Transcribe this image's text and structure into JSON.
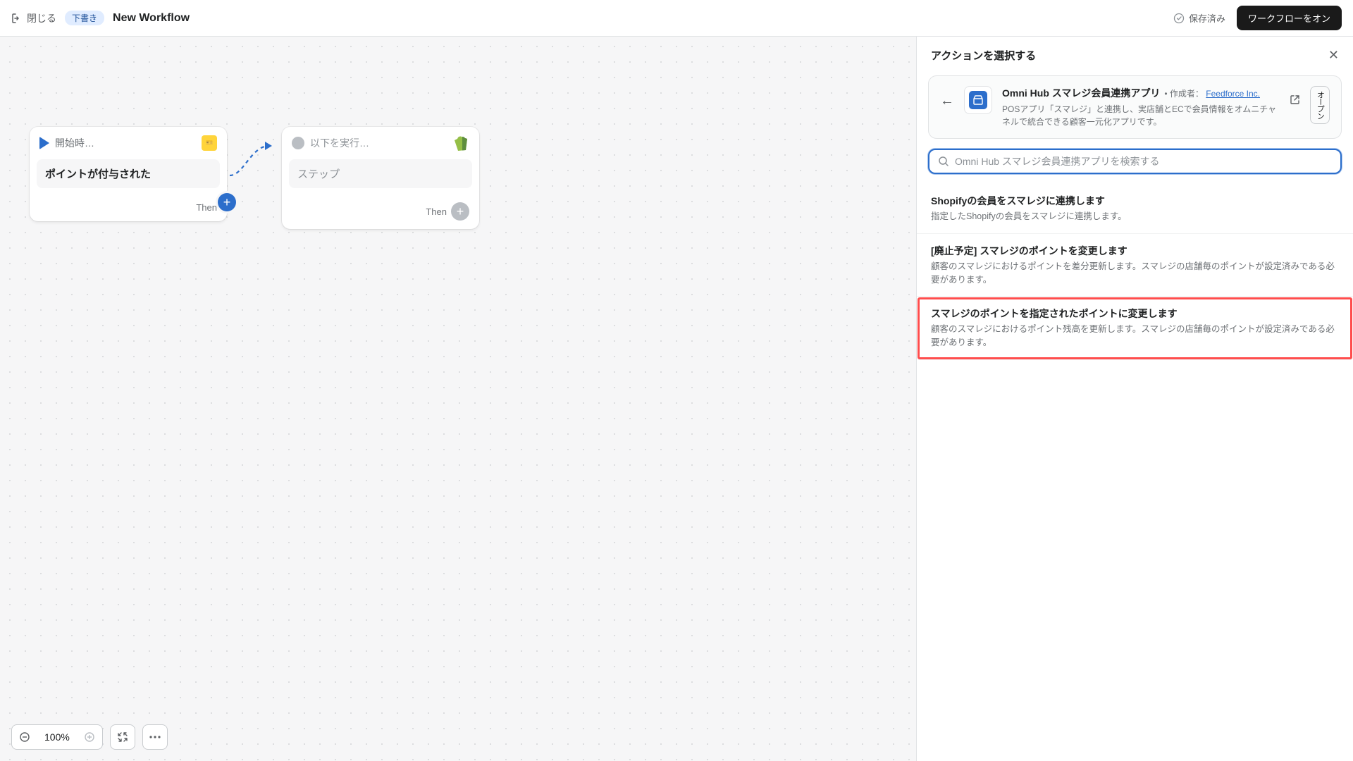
{
  "header": {
    "close_label": "閉じる",
    "draft_badge": "下書き",
    "title": "New Workflow",
    "saved_label": "保存済み",
    "enable_button": "ワークフローをオン"
  },
  "canvas": {
    "node1": {
      "header": "開始時…",
      "body": "ポイントが付与された",
      "then": "Then"
    },
    "node2": {
      "header": "以下を実行…",
      "body": "ステップ",
      "then": "Then"
    },
    "zoom": "100%"
  },
  "panel": {
    "title": "アクションを選択する",
    "app": {
      "name": "Omni Hub スマレジ会員連携アプリ",
      "author_prefix": "作成者：",
      "author_link": "Feedforce Inc.",
      "description": "POSアプリ「スマレジ」と連携し、実店舗とECで会員情報をオムニチャネルで統合できる顧客一元化アプリです。",
      "open_label": "オープン"
    },
    "search_placeholder": "Omni Hub スマレジ会員連携アプリを検索する",
    "actions": [
      {
        "title": "Shopifyの会員をスマレジに連携します",
        "desc": "指定したShopifyの会員をスマレジに連携します。"
      },
      {
        "title": "[廃止予定] スマレジのポイントを変更します",
        "desc": "顧客のスマレジにおけるポイントを差分更新します。スマレジの店舗毎のポイントが設定済みである必要があります。"
      },
      {
        "title": "スマレジのポイントを指定されたポイントに変更します",
        "desc": "顧客のスマレジにおけるポイント残高を更新します。スマレジの店舗毎のポイントが設定済みである必要があります。"
      }
    ]
  }
}
